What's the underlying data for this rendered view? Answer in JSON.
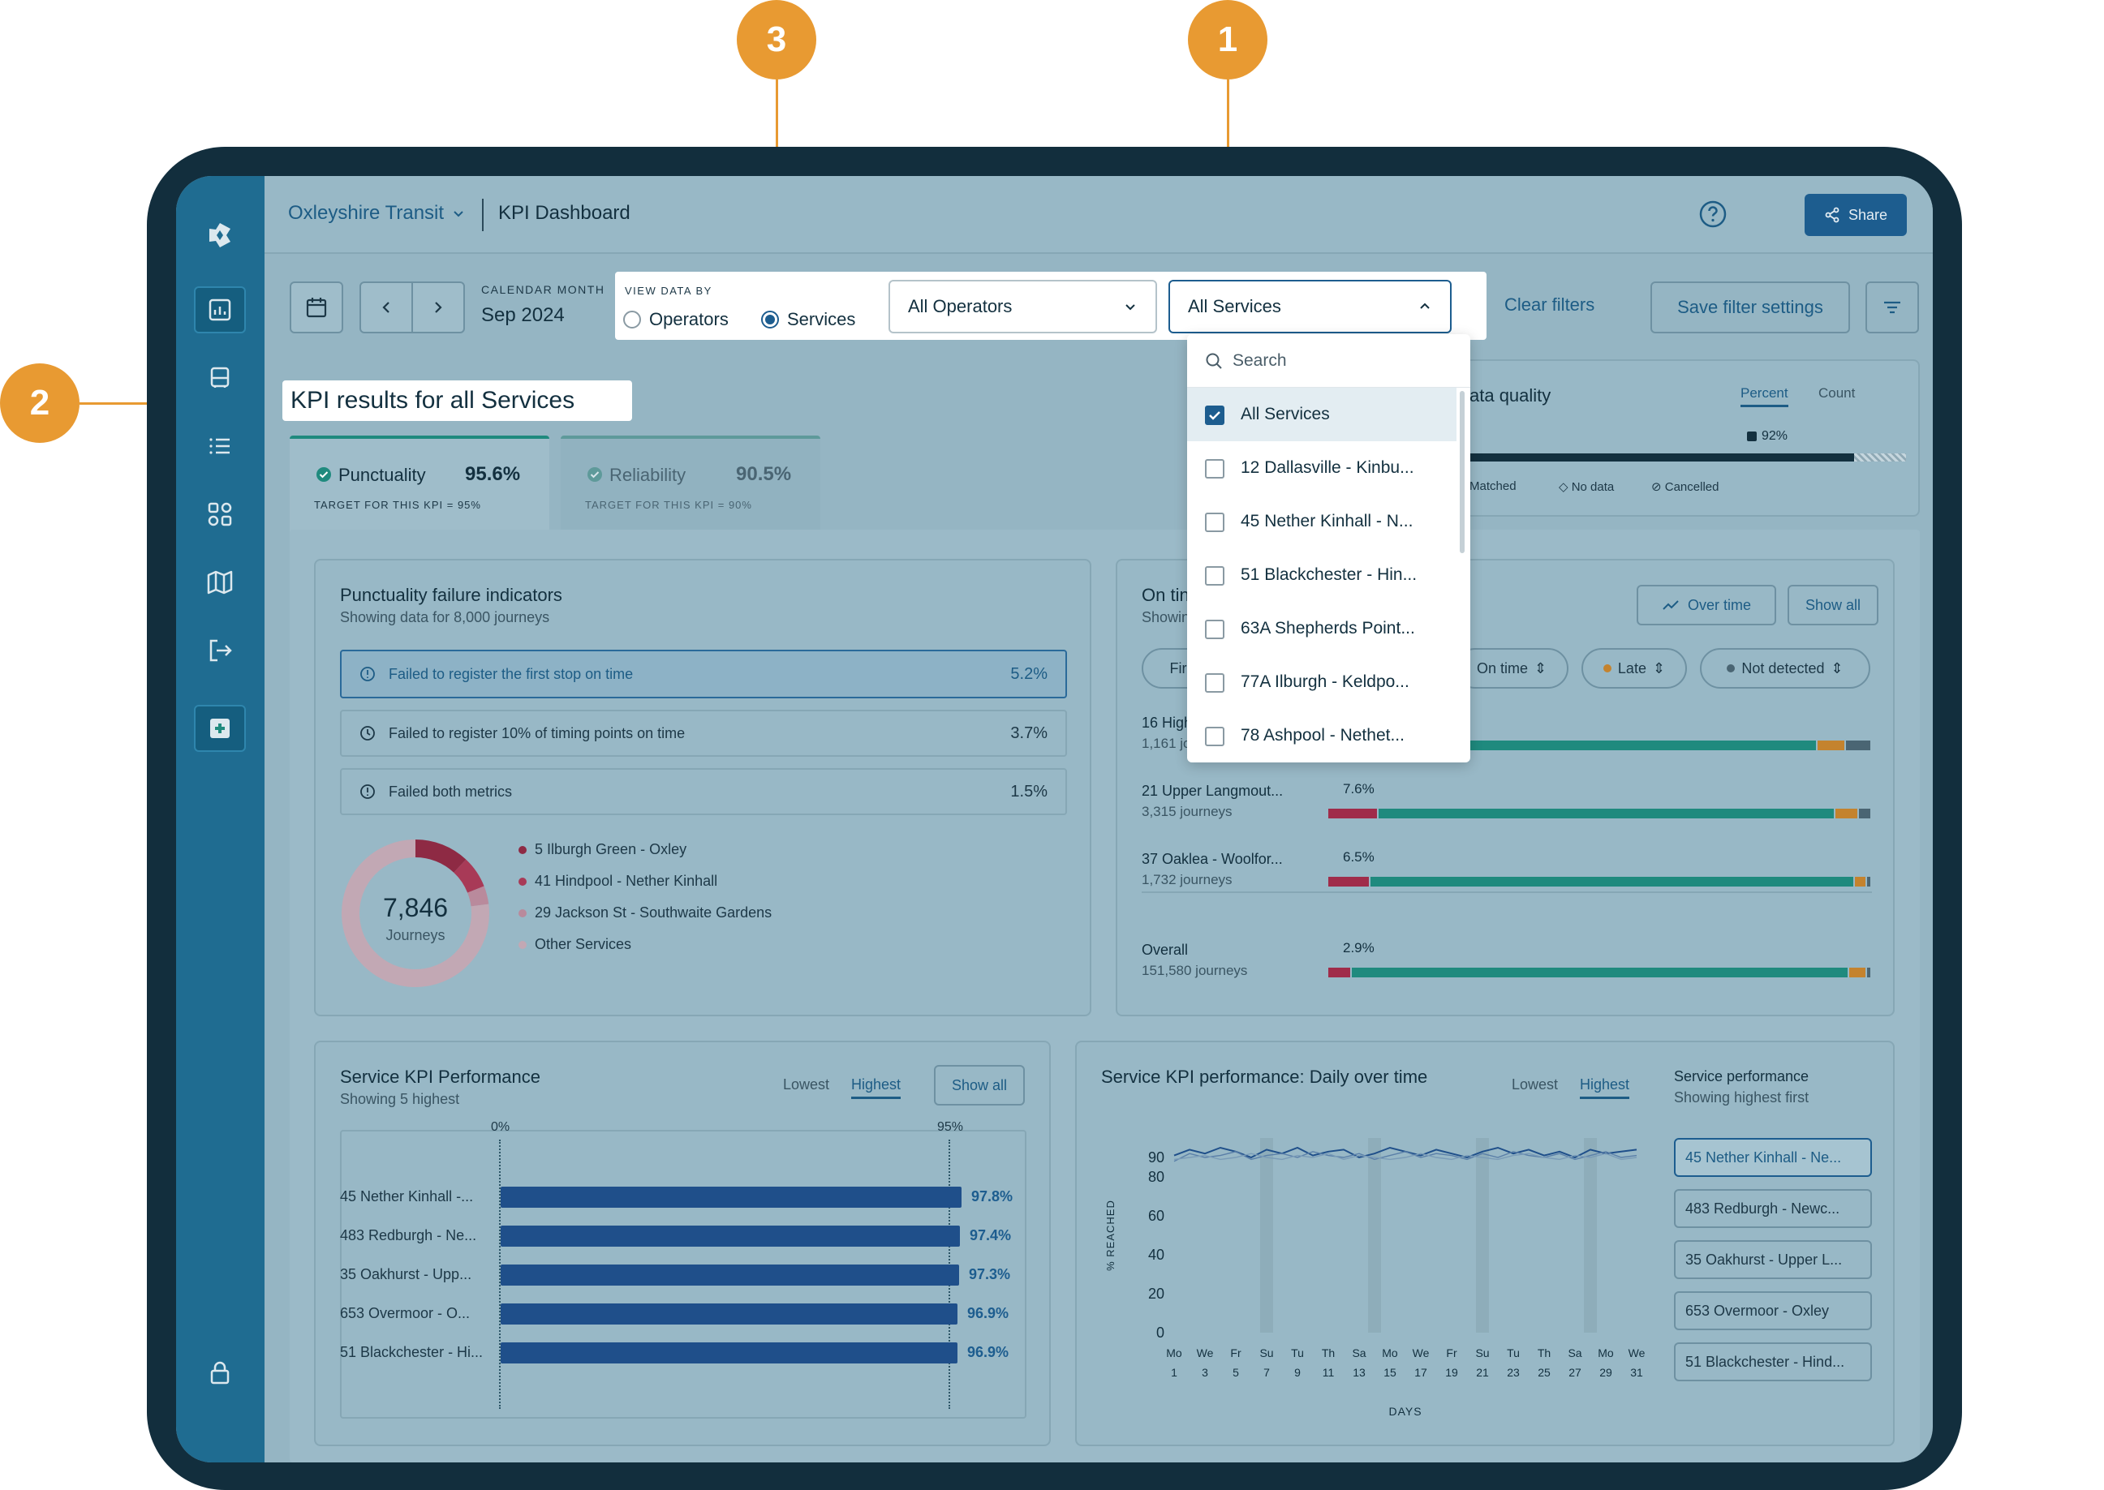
{
  "app": {
    "org": "Oxleyshire Transit",
    "page_title": "KPI Dashboard",
    "share_label": "Share"
  },
  "filters": {
    "calendar_caption": "CALENDAR MONTH",
    "calendar_value": "Sep 2024",
    "view_caption": "VIEW DATA BY",
    "view_options": [
      "Operators",
      "Services"
    ],
    "view_selected": "Services",
    "operators_value": "All Operators",
    "services_value": "All Services",
    "clear_label": "Clear filters",
    "save_label": "Save filter settings"
  },
  "dropdown": {
    "search_placeholder": "Search",
    "items": [
      {
        "label": "All Services",
        "checked": true
      },
      {
        "label": "12 Dallasville - Kinbu...",
        "checked": false
      },
      {
        "label": "45 Nether Kinhall - N...",
        "checked": false
      },
      {
        "label": "51 Blackchester - Hin...",
        "checked": false
      },
      {
        "label": "63A Shepherds Point...",
        "checked": false
      },
      {
        "label": "77A Ilburgh - Keldpo...",
        "checked": false
      },
      {
        "label": "78 Ashpool - Nethet...",
        "checked": false
      }
    ]
  },
  "results_heading": "KPI results for all Services",
  "kpi_tabs": [
    {
      "name": "Punctuality",
      "value": "95.6%",
      "target": "TARGET FOR THIS KPI = 95%"
    },
    {
      "name": "Reliability",
      "value": "90.5%",
      "target": "TARGET FOR THIS KPI = 90%"
    }
  ],
  "data_quality": {
    "title": "ata quality",
    "tabs": [
      "Percent",
      "Count"
    ],
    "pct_label": "92%",
    "legend": [
      "Matched",
      "No data",
      "Cancelled"
    ]
  },
  "failure_panel": {
    "title": "Punctuality failure indicators",
    "subtitle": "Showing data for 8,000 journeys",
    "rows": [
      {
        "label": "Failed to register the first stop on time",
        "pct": "5.2%"
      },
      {
        "label": "Failed to register 10% of timing points on time",
        "pct": "3.7%"
      },
      {
        "label": "Failed both metrics",
        "pct": "1.5%"
      }
    ],
    "donut_value": "7,846",
    "donut_caption": "Journeys",
    "donut_legend": [
      {
        "label": "5 Ilburgh Green - Oxley",
        "color": "#8e2a44"
      },
      {
        "label": "41 Hindpool - Nether Kinhall",
        "color": "#a83a57"
      },
      {
        "label": "29 Jackson St - Southwaite Gardens",
        "color": "#b98a9c"
      },
      {
        "label": "Other Services",
        "color": "#c2a8b4"
      }
    ],
    "donut_shares": [
      0.12,
      0.07,
      0.04,
      0.77
    ]
  },
  "ontime_panel": {
    "title": "On tin",
    "subtitle": "Showin",
    "buttons": [
      "Over time",
      "Show all"
    ],
    "chips": [
      "Fir",
      "On time",
      "Late",
      "Not detected"
    ],
    "rows": [
      {
        "name": "16 High",
        "journeys": "1,161 jou",
        "pct": "",
        "red": 0,
        "green": 0.9,
        "orange": 0.05
      },
      {
        "name": "21 Upper Langmout...",
        "journeys": "3,315 journeys",
        "pct": "7.6%",
        "red": 0.09,
        "green": 0.84,
        "orange": 0.04
      },
      {
        "name": "37 Oaklea - Woolfor...",
        "journeys": "1,732 journeys",
        "pct": "6.5%",
        "red": 0.075,
        "green": 0.89,
        "orange": 0.02
      },
      {
        "name": "Overall",
        "journeys": "151,580 journeys",
        "pct": "2.9%",
        "red": 0.04,
        "green": 0.915,
        "orange": 0.03
      }
    ]
  },
  "service_perf": {
    "title": "Service KPI Performance",
    "subtitle": "Showing 5 highest",
    "tabs": [
      "Lowest",
      "Highest"
    ],
    "show_all": "Show all",
    "axis_start": "0%",
    "axis_target": "95%",
    "bars": [
      {
        "label": "45 Nether Kinhall -...",
        "value": 97.8,
        "pct": "97.8%"
      },
      {
        "label": "483 Redburgh - Ne...",
        "value": 97.4,
        "pct": "97.4%"
      },
      {
        "label": "35 Oakhurst - Upp...",
        "value": 97.3,
        "pct": "97.3%"
      },
      {
        "label": "653 Overmoor - O...",
        "value": 96.9,
        "pct": "96.9%"
      },
      {
        "label": "51 Blackchester - Hi...",
        "value": 96.9,
        "pct": "96.9%"
      }
    ]
  },
  "daily_perf": {
    "title": "Service KPI performance: Daily over time",
    "tabs": [
      "Lowest",
      "Highest"
    ],
    "side_title": "Service performance",
    "side_subtitle": "Showing highest first",
    "side_items": [
      "45 Nether Kinhall - Ne...",
      "483 Redburgh - Newc...",
      "35 Oakhurst - Upper L...",
      "653 Overmoor - Oxley",
      "51 Blackchester - Hind..."
    ],
    "ylabel": "% REACHED",
    "xlabel": "DAYS"
  },
  "chart_data": {
    "type": "line",
    "title": "Service KPI performance: Daily over time",
    "xlabel": "DAYS",
    "ylabel": "% REACHED",
    "y_ticks": [
      0,
      20,
      40,
      60,
      80,
      90
    ],
    "ylim": [
      0,
      100
    ],
    "x_day_labels": [
      "Mo",
      "We",
      "Fr",
      "Su",
      "Tu",
      "Th",
      "Sa",
      "Mo",
      "We",
      "Fr",
      "Su",
      "Tu",
      "Th",
      "Sa",
      "Mo",
      "We"
    ],
    "x_date_labels": [
      "1",
      "3",
      "5",
      "7",
      "9",
      "11",
      "13",
      "15",
      "17",
      "19",
      "21",
      "23",
      "25",
      "27",
      "29",
      "31"
    ],
    "series": [
      {
        "values": [
          91,
          94,
          92,
          95,
          93,
          90,
          94,
          92,
          95,
          91,
          93,
          94,
          90,
          92,
          95,
          93,
          91,
          94,
          92,
          90,
          93,
          95,
          92,
          94,
          91,
          93,
          90,
          94,
          92,
          93,
          94
        ]
      },
      {
        "values": [
          88,
          92,
          90,
          91,
          93,
          89,
          91,
          92,
          90,
          93,
          91,
          90,
          92,
          89,
          91,
          93,
          90,
          92,
          91,
          89,
          92,
          90,
          93,
          91,
          90,
          92,
          89,
          91,
          93,
          90,
          91
        ]
      },
      {
        "values": [
          89,
          90,
          91,
          89,
          90,
          92,
          90,
          89,
          91,
          90,
          92,
          89,
          91,
          90,
          89,
          90,
          92,
          90,
          89,
          91,
          90,
          89,
          91,
          92,
          90,
          89,
          91,
          90,
          92,
          89,
          90
        ]
      }
    ]
  },
  "colors": {
    "accent": "#1d5d8f",
    "callout": "#e89a32",
    "green": "#1f8a7e",
    "red": "#a02c4a",
    "orange": "#c4832e"
  },
  "callouts": [
    "1",
    "2",
    "3"
  ]
}
